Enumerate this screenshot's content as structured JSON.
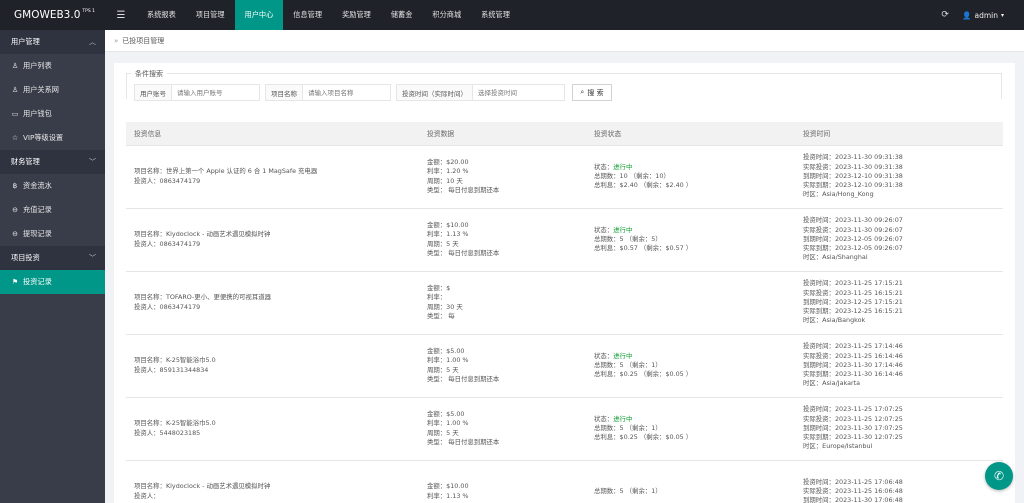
{
  "brand": {
    "name": "GMOWEB3.0",
    "tag": "TPS 1"
  },
  "topnav": {
    "items": [
      "系统报表",
      "项目管理",
      "用户中心",
      "信息管理",
      "奖励管理",
      "储蓄金",
      "积分商城",
      "系统管理"
    ],
    "active_index": 2
  },
  "user": {
    "name": "admin"
  },
  "sidebar": {
    "groups": [
      {
        "label": "用户管理",
        "items": [
          "用户列表",
          "用户关系网",
          "用户钱包",
          "VIP等级设置"
        ]
      },
      {
        "label": "财务管理",
        "items": [
          "资金流水",
          "充值记录",
          "提现记录"
        ]
      },
      {
        "label": "项目投资",
        "items": [
          "投资记录"
        ]
      }
    ],
    "active_item": "投资记录"
  },
  "breadcrumb": {
    "text": "已投项目管理"
  },
  "search": {
    "legend": "条件搜索",
    "fields": [
      {
        "label": "用户账号",
        "placeholder": "请输入用户账号"
      },
      {
        "label": "项目名称",
        "placeholder": "请输入项目名称"
      },
      {
        "label": "投资时间（实际时间）",
        "placeholder": "选择投资时间"
      }
    ],
    "button": "搜 索"
  },
  "table": {
    "headers": [
      "投资信息",
      "投资数据",
      "投资状态",
      "投资时间"
    ],
    "rows": [
      {
        "info": [
          "项目名称：世界上第一个 Apple 认证的 6 合 1 MagSafe 充电器",
          "投资人：0863474179"
        ],
        "data": [
          "金额：$20.00",
          "利率：1.20 %",
          "周期：10 天",
          "类型：  每日付息到期还本"
        ],
        "status": [
          "状态：",
          "进行中",
          "总期数：10 （剩余：10）",
          "总利息：$2.40 （剩余：$2.40 ）"
        ],
        "time": [
          "投资时间：2023-11-30 09:31:38",
          "实际投资：2023-11-30 09:31:38",
          "到期时间：2023-12-10 09:31:38",
          "实际到期：2023-12-10 09:31:38",
          "时区：Asia/Hong_Kong"
        ]
      },
      {
        "info": [
          "项目名称：Klydoclock - 动画艺术遇见模拟时钟",
          "投资人：0863474179"
        ],
        "data": [
          "金额：$10.00",
          "利率：1.13 %",
          "周期：5 天",
          "类型：  每日付息到期还本"
        ],
        "status": [
          "状态：",
          "进行中",
          "总期数：5 （剩余：5）",
          "总利息：$0.57 （剩余：$0.57 ）"
        ],
        "time": [
          "投资时间：2023-11-30 09:26:07",
          "实际投资：2023-11-30 09:26:07",
          "到期时间：2023-12-05 09:26:07",
          "实际到期：2023-12-05 09:26:07",
          "时区：Asia/Shanghai"
        ]
      },
      {
        "info": [
          "项目名称：TOFARO-更小、更便携的可视耳道器",
          "投资人：0863474179"
        ],
        "data": [
          "金额：$",
          "利率：",
          "周期：30 天",
          "类型：  每"
        ],
        "status": [
          "",
          "",
          "",
          ""
        ],
        "time": [
          "投资时间：2023-11-25 17:15:21",
          "实际投资：2023-11-25 16:15:21",
          "到期时间：2023-12-25 17:15:21",
          "实际到期：2023-12-25 16:15:21",
          "时区：Asia/Bangkok"
        ]
      },
      {
        "info": [
          "项目名称：K-25智能浴巾5.0",
          "投资人：859131344834"
        ],
        "data": [
          "金额：$5.00",
          "利率：1.00 %",
          "周期：5 天",
          "类型：  每日付息到期还本"
        ],
        "status": [
          "状态：",
          "进行中",
          "总期数：5 （剩余：1）",
          "总利息：$0.25 （剩余：$0.05 ）"
        ],
        "time": [
          "投资时间：2023-11-25 17:14:46",
          "实际投资：2023-11-25 16:14:46",
          "到期时间：2023-11-30 17:14:46",
          "实际到期：2023-11-30 16:14:46",
          "时区：Asia/Jakarta"
        ]
      },
      {
        "info": [
          "项目名称：K-25智能浴巾5.0",
          "投资人：5448023185"
        ],
        "data": [
          "金额：$5.00",
          "利率：1.00 %",
          "周期：5 天",
          "类型：  每日付息到期还本"
        ],
        "status": [
          "状态：",
          "进行中",
          "总期数：5 （剩余：1）",
          "总利息：$0.25 （剩余：$0.05 ）"
        ],
        "time": [
          "投资时间：2023-11-25 17:07:25",
          "实际投资：2023-11-25 12:07:25",
          "到期时间：2023-11-30 17:07:25",
          "实际到期：2023-11-30 12:07:25",
          "时区：Europe/Istanbul"
        ]
      },
      {
        "info": [
          "项目名称：Klydoclock - 动画艺术遇见模拟时钟",
          "投资人："
        ],
        "data": [
          "金额：$10.00",
          "利率：1.13 %",
          "",
          ""
        ],
        "status": [
          "",
          "",
          "总期数：5 （剩余：1）",
          ""
        ],
        "time": [
          "投资时间：2023-11-25 17:06:48",
          "实际投资：2023-11-25 16:06:48",
          "到期时间：2023-11-30 17:06:48",
          "",
          ""
        ]
      }
    ]
  },
  "colors": {
    "accent": "#009688",
    "topbar": "#20222a",
    "sidebar": "#393d49",
    "status_active": "#0c9a2f"
  },
  "icons": {
    "menu": "hamburger-icon",
    "refresh": "refresh-icon",
    "user": "user-icon",
    "float": "support-icon"
  }
}
